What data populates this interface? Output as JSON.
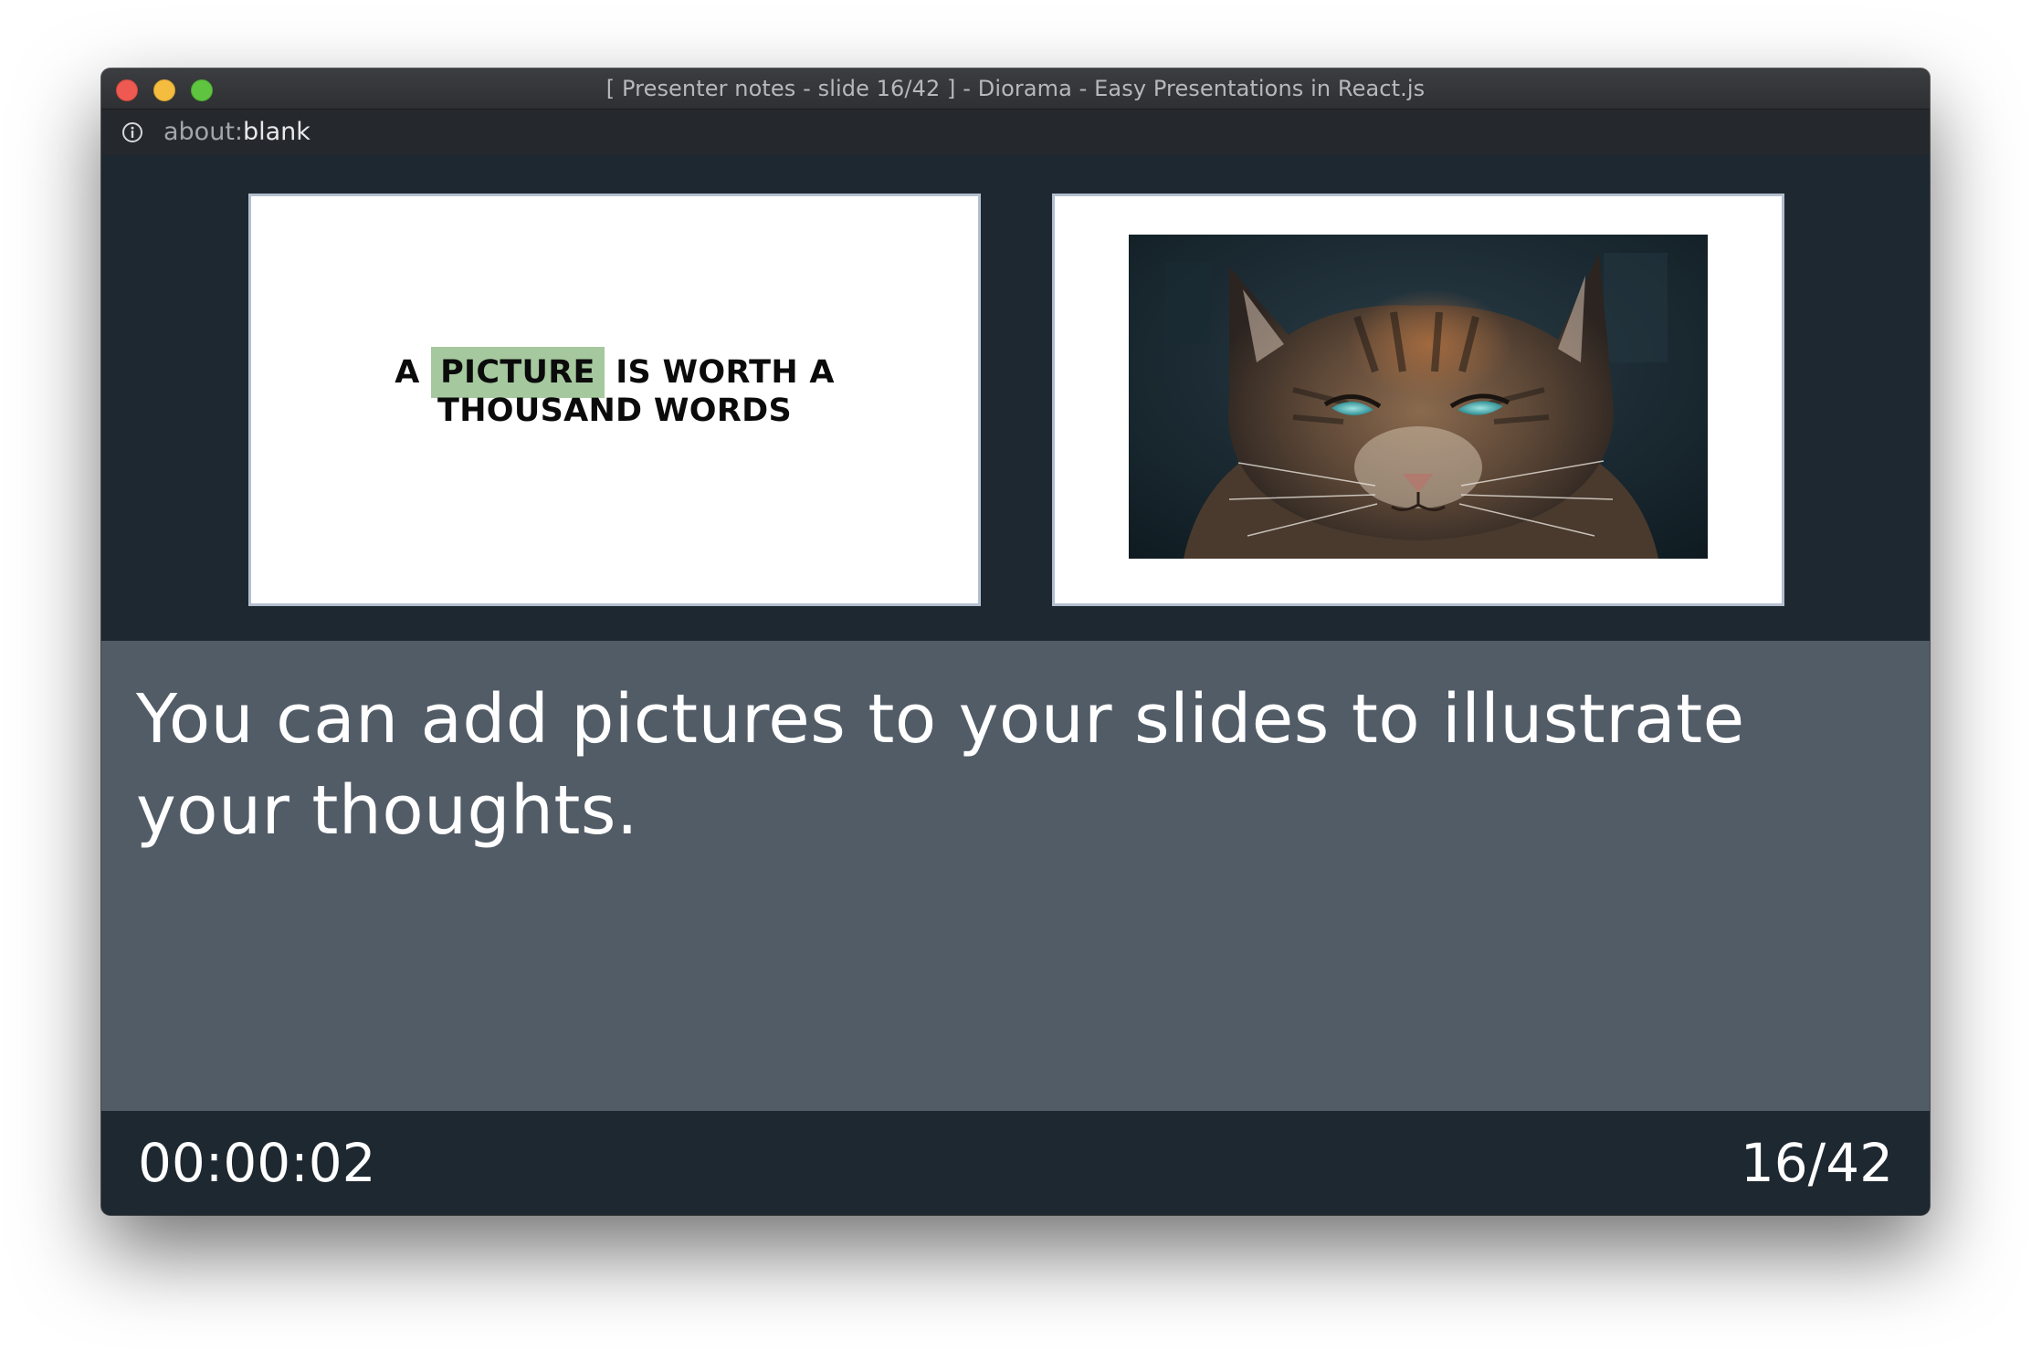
{
  "window": {
    "title": "[ Presenter notes - slide 16/42 ] - Diorama - Easy Presentations in React.js"
  },
  "address_bar": {
    "url_scheme": "about:",
    "url_rest": "blank",
    "icon": "info-icon"
  },
  "current_slide": {
    "text_before": "A ",
    "highlight": "PICTURE",
    "text_after_line1": " IS WORTH A",
    "line2": "THOUSAND WORDS",
    "highlight_color": "#a6c89f"
  },
  "next_slide": {
    "image": "cat-photo"
  },
  "notes": {
    "text": "You can add pictures to your slides to illustrate your thoughts."
  },
  "footer": {
    "timer": "00:00:02",
    "slide_counter": "16/42"
  },
  "colors": {
    "background_dark": "#1e2831",
    "notes_background": "#525c67",
    "slide_border": "#b3bfcf"
  }
}
